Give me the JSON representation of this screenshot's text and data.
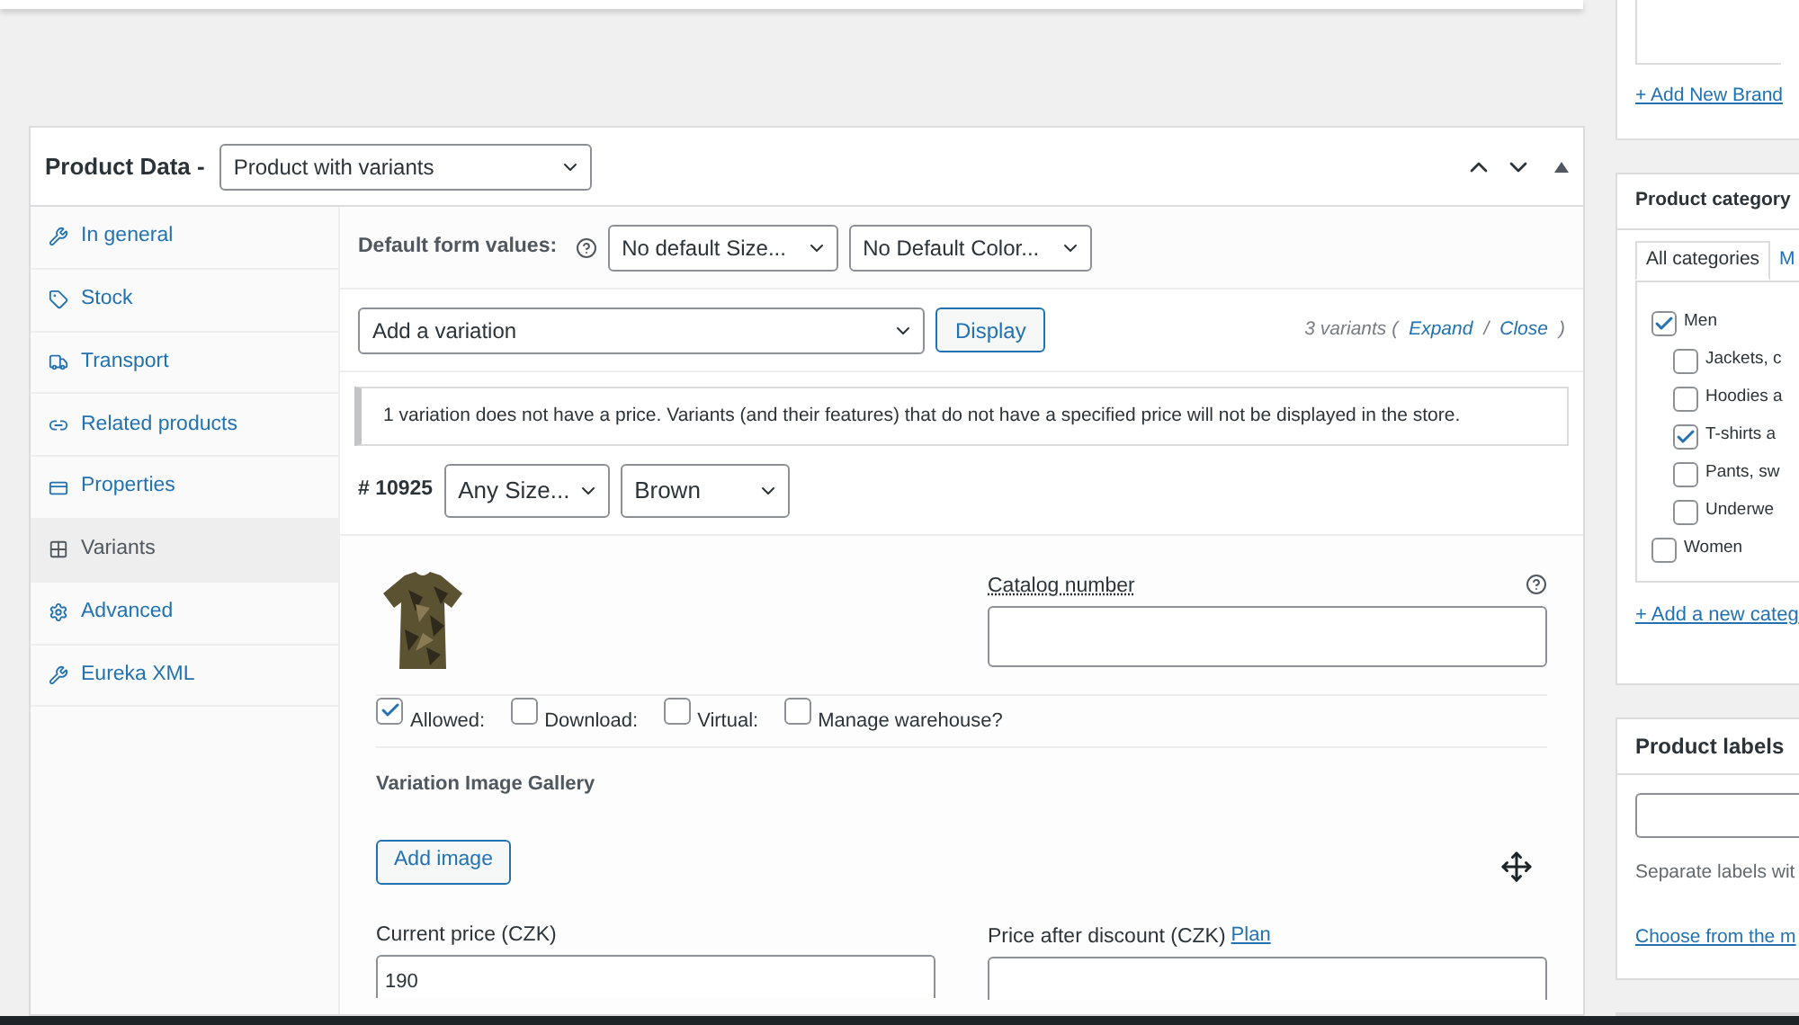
{
  "product_data": {
    "title": "Product Data -",
    "type_select": "Product with variants"
  },
  "sidebar": {
    "items": [
      {
        "label": "In general",
        "selected": false
      },
      {
        "label": "Stock",
        "selected": false
      },
      {
        "label": "Transport",
        "selected": false
      },
      {
        "label": "Related products",
        "selected": false
      },
      {
        "label": "Properties",
        "selected": false
      },
      {
        "label": "Variants",
        "selected": true
      },
      {
        "label": "Advanced",
        "selected": false
      },
      {
        "label": "Eureka XML",
        "selected": false
      }
    ]
  },
  "default_form": {
    "label": "Default form values:",
    "selects": [
      "No default Size...",
      "No Default Color..."
    ]
  },
  "add_variation": {
    "select": "Add a variation",
    "button": "Display",
    "count": "3 variants (",
    "expand": "Expand",
    "separator": "/",
    "close": "Close",
    "end": ")"
  },
  "notice": "1 variation does not have a price. Variants (and their features) that do not have a specified price will not be displayed in the store.",
  "variant": {
    "id": "# 10925",
    "selects": [
      "Any Size...",
      "Brown"
    ],
    "catalog_label": "Catalog number",
    "options": [
      {
        "label": "Allowed:",
        "checked": true
      },
      {
        "label": "Download:",
        "checked": false
      },
      {
        "label": "Virtual:",
        "checked": false
      },
      {
        "label": "Manage warehouse?",
        "checked": false
      }
    ],
    "gallery_title": "Variation Image Gallery",
    "add_image": "Add image",
    "price_label": "Current price (CZK)",
    "price_value": "190",
    "discount_label": "Price after discount (CZK)",
    "plan_link": "Plan"
  },
  "brand_box": {
    "link": "+ Add New Brand"
  },
  "category_box": {
    "title": "Product category",
    "tabs": [
      {
        "label": "All categories",
        "selected": true
      },
      {
        "label": "M",
        "selected": false
      }
    ],
    "tree": [
      {
        "label": "Men",
        "checked": true,
        "children": [
          {
            "label": "Jackets, c",
            "checked": false
          },
          {
            "label": "Hoodies a",
            "checked": false
          },
          {
            "label": "T-shirts a",
            "checked": true
          },
          {
            "label": "Pants, sw",
            "checked": false
          },
          {
            "label": "Underwe",
            "checked": false
          }
        ]
      },
      {
        "label": "Women",
        "checked": false
      }
    ],
    "link": "+ Add a new categ"
  },
  "labels_box": {
    "title": "Product labels",
    "hint": "Separate labels wit",
    "link": "Choose from the m"
  }
}
